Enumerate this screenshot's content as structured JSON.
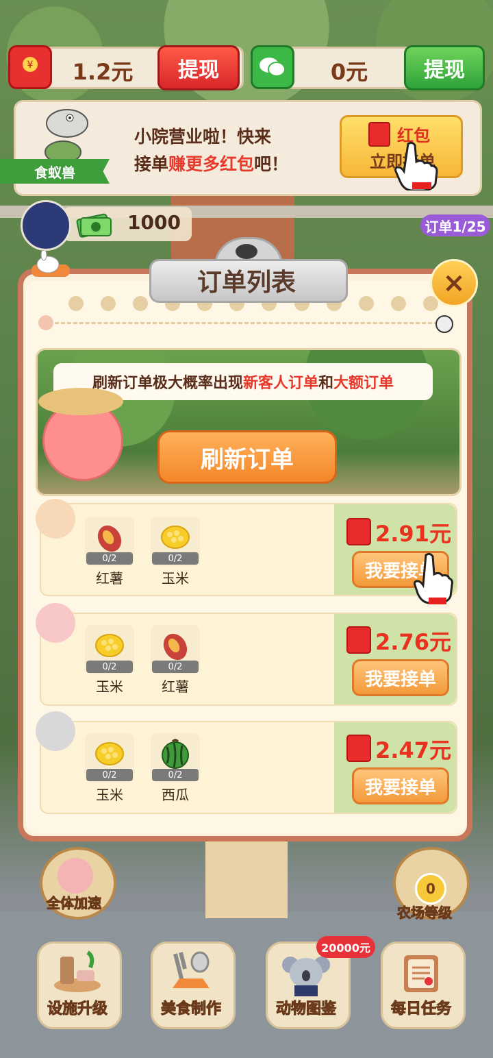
{
  "wallet": {
    "redpack_amount": "1.2元",
    "redpack_withdraw": "提现",
    "wechat_amount": "0元",
    "wechat_withdraw": "提现"
  },
  "banner": {
    "character_name": "食蚁兽",
    "line1": "小院营业啦！快来",
    "line2_a": "接单",
    "line2_b": "赚更多红包",
    "line2_c": "吧！",
    "button_top": "红包",
    "button_bottom": "立即接单"
  },
  "player": {
    "coins": "1000",
    "orders_progress": "订单1/25"
  },
  "panel": {
    "title": "订单列表",
    "close": "×",
    "tip_a": "刷新订单极大概率出现",
    "tip_b": "新客人订单",
    "tip_c": "和",
    "tip_d": "大额订单",
    "refresh_button": "刷新订单"
  },
  "orders": [
    {
      "items": [
        {
          "name": "红薯",
          "count": "0/2",
          "icon": "sweet-potato-icon"
        },
        {
          "name": "玉米",
          "count": "0/2",
          "icon": "corn-icon"
        }
      ],
      "reward": "2.91元",
      "button": "我要接单"
    },
    {
      "items": [
        {
          "name": "玉米",
          "count": "0/2",
          "icon": "corn-icon"
        },
        {
          "name": "红薯",
          "count": "0/2",
          "icon": "sweet-potato-icon"
        }
      ],
      "reward": "2.76元",
      "button": "我要接单"
    },
    {
      "items": [
        {
          "name": "玉米",
          "count": "0/2",
          "icon": "corn-icon"
        },
        {
          "name": "西瓜",
          "count": "0/2",
          "icon": "watermelon-icon"
        }
      ],
      "reward": "2.47元",
      "button": "我要接单"
    }
  ],
  "tools": {
    "speed_all": "全体加速",
    "farm_level": "农场等级",
    "farm_level_value": "0"
  },
  "nav": [
    {
      "label": "设施升级"
    },
    {
      "label": "美食制作"
    },
    {
      "label": "动物图鉴",
      "badge": "20000元"
    },
    {
      "label": "每日任务"
    }
  ],
  "colors": {
    "panel_border": "#c9775a",
    "reward_red": "#e8321f",
    "accept_orange": "#f39a3b",
    "wechat_green": "#2fa23a"
  }
}
